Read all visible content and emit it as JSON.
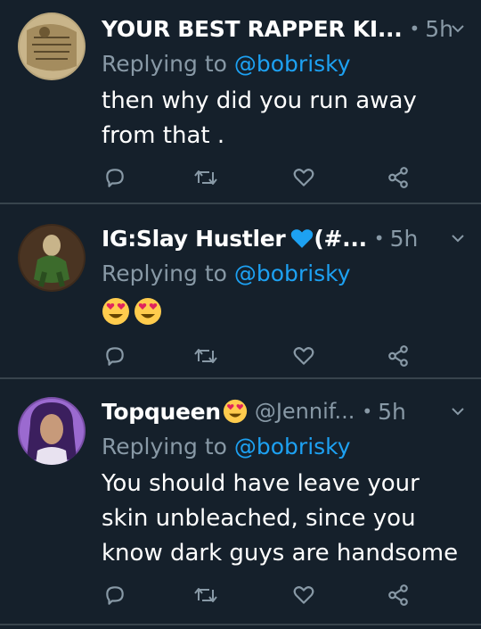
{
  "tweets": [
    {
      "name": "YOUR BEST RAPPER KI...",
      "handle": "",
      "dot": "•",
      "time": "5h",
      "reply_prefix": "Replying to ",
      "reply_to": "@bobrisky",
      "text": "then why did you run away from that ."
    },
    {
      "name": "IG:Slay Hustler",
      "name_suffix": " (#...",
      "handle": "",
      "dot": "•",
      "time": "5h",
      "reply_prefix": "Replying to ",
      "reply_to": "@bobrisky",
      "text": "",
      "emoji": [
        "heart-eyes-emoji",
        "heart-eyes-emoji"
      ]
    },
    {
      "name": "Topqueen",
      "handle": "@Jennif...",
      "dot": "•",
      "time": "5h",
      "reply_prefix": "Replying to ",
      "reply_to": "@bobrisky",
      "text": "You should have leave your skin unbleached, since you know dark guys are handsome"
    }
  ],
  "icons": {
    "reply": "reply-icon",
    "retweet": "retweet-icon",
    "like": "heart-icon",
    "share": "share-icon",
    "menu": "chevron-down-icon"
  },
  "colors": {
    "background": "#15202b",
    "divider": "#38444d",
    "secondary_text": "#8899a6",
    "link": "#1da1f2",
    "blue_heart": "#1da1f2"
  }
}
